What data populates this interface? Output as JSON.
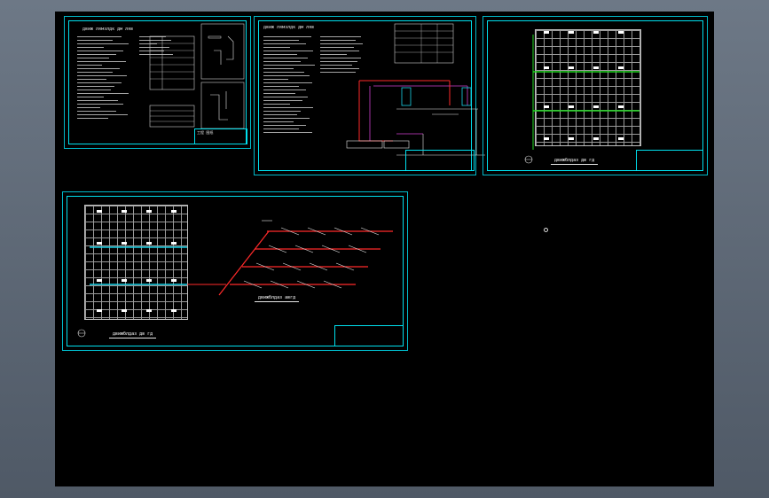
{
  "colors": {
    "background": "#000000",
    "frame": "#00e0ee",
    "pipe_red": "#ff2a2a",
    "pipe_green": "#1fd31f",
    "pipe_cyan": "#19d3e8",
    "pipe_magenta": "#d040d0",
    "text": "#e6e6e6"
  },
  "sheets": [
    {
      "id": "sheet-1",
      "heading": "движ лямзлдк дм ляв",
      "title_block_label": "工程 图纸"
    },
    {
      "id": "sheet-2",
      "heading": "движ лямзлдк дм ляв"
    },
    {
      "id": "sheet-3",
      "caption": "движблдаз дв гд"
    },
    {
      "id": "sheet-4",
      "caption_plan": "движблдаз дв гд",
      "caption_iso": "движблдаз авгд"
    }
  ]
}
